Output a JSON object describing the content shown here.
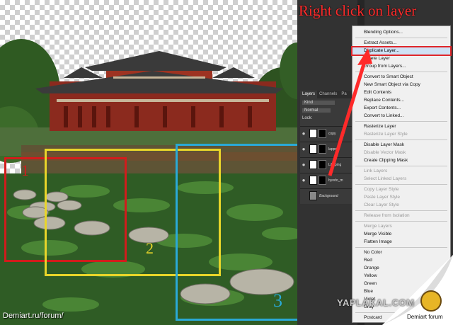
{
  "annotation": {
    "title": "Right click on layer",
    "box_numbers": [
      "1",
      "2",
      "3"
    ]
  },
  "watermark": {
    "left": "Demiart.ru/forum/",
    "site": "YAPLAKAL.COM",
    "badge_label": "Demiart forum"
  },
  "layers_panel": {
    "tabs": [
      "Layers",
      "Channels",
      "Pa"
    ],
    "kind_label": "Kind",
    "blend_mode": "Normal",
    "lock_label": "Lock:",
    "layers": [
      {
        "name": "copy",
        "italic": false
      },
      {
        "name": "lappng",
        "italic": false
      },
      {
        "name": "Lilipping",
        "italic": false
      },
      {
        "name": "byodo_m",
        "italic": false
      },
      {
        "name": "Background",
        "italic": true
      }
    ]
  },
  "context_menu": {
    "items": [
      {
        "label": "Blending Options...",
        "state": "enabled"
      },
      {
        "label": "Extract Assets...",
        "state": "enabled"
      },
      {
        "label": "Duplicate Layer...",
        "state": "highlighted"
      },
      {
        "label": "Delete Layer",
        "state": "enabled"
      },
      {
        "label": "Group from Layers...",
        "state": "enabled"
      },
      {
        "label": "Convert to Smart Object",
        "state": "enabled"
      },
      {
        "label": "New Smart Object via Copy",
        "state": "enabled"
      },
      {
        "label": "Edit Contents",
        "state": "enabled"
      },
      {
        "label": "Replace Contents...",
        "state": "enabled"
      },
      {
        "label": "Export Contents...",
        "state": "enabled"
      },
      {
        "label": "Convert to Linked...",
        "state": "enabled"
      },
      {
        "label": "Rasterize Layer",
        "state": "enabled"
      },
      {
        "label": "Rasterize Layer Style",
        "state": "disabled"
      },
      {
        "label": "Disable Layer Mask",
        "state": "enabled"
      },
      {
        "label": "Disable Vector Mask",
        "state": "disabled"
      },
      {
        "label": "Create Clipping Mask",
        "state": "enabled"
      },
      {
        "label": "Link Layers",
        "state": "disabled"
      },
      {
        "label": "Select Linked Layers",
        "state": "disabled"
      },
      {
        "label": "Copy Layer Style",
        "state": "disabled"
      },
      {
        "label": "Paste Layer Style",
        "state": "disabled"
      },
      {
        "label": "Clear Layer Style",
        "state": "disabled"
      },
      {
        "label": "Release from Isolation",
        "state": "disabled"
      },
      {
        "label": "Merge Layers",
        "state": "disabled"
      },
      {
        "label": "Merge Visible",
        "state": "enabled"
      },
      {
        "label": "Flatten Image",
        "state": "enabled"
      },
      {
        "label": "No Color",
        "state": "enabled"
      },
      {
        "label": "Red",
        "state": "enabled"
      },
      {
        "label": "Orange",
        "state": "enabled"
      },
      {
        "label": "Yellow",
        "state": "enabled"
      },
      {
        "label": "Green",
        "state": "enabled"
      },
      {
        "label": "Blue",
        "state": "enabled"
      },
      {
        "label": "Violet",
        "state": "enabled"
      },
      {
        "label": "Gray",
        "state": "enabled"
      },
      {
        "label": "Postcard",
        "state": "enabled"
      }
    ]
  },
  "colors": {
    "annotation_red": "#ff2a2a",
    "box_red": "#d11c1c",
    "box_yellow": "#e8d52a",
    "box_blue": "#2aa9d6",
    "menu_highlight": "#cfe2f5"
  }
}
